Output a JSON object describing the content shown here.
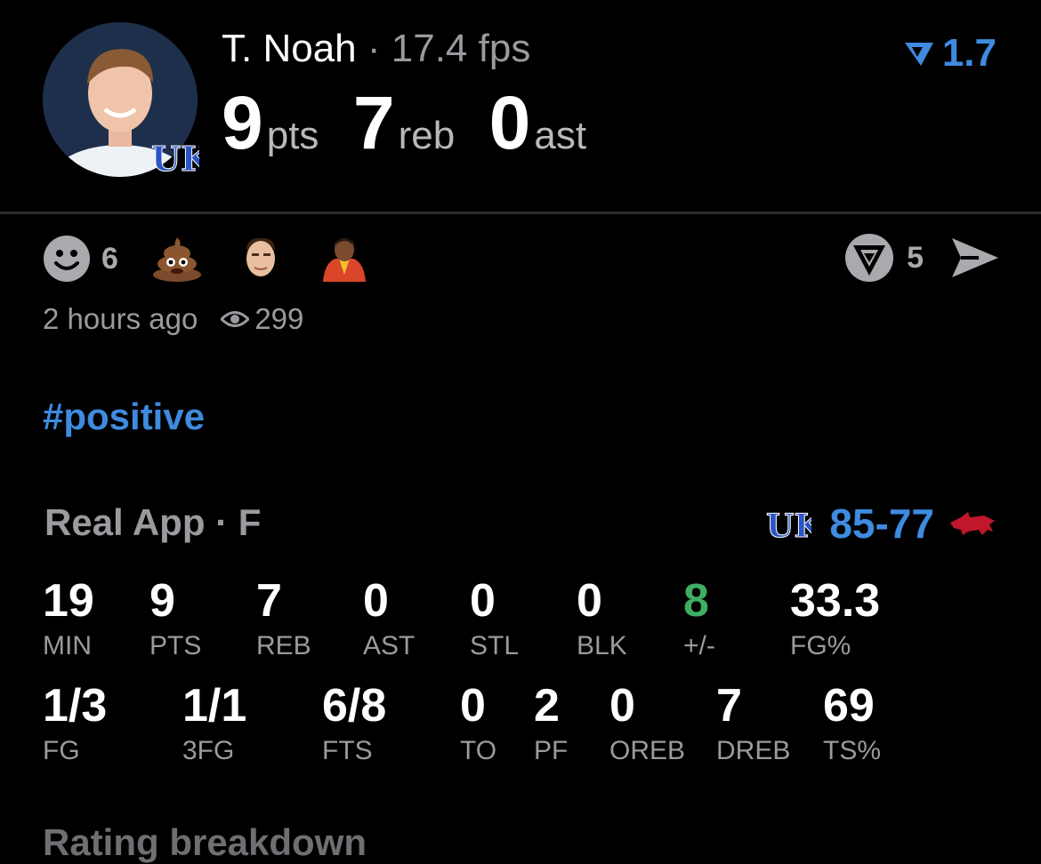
{
  "player": {
    "name": "T. Noah",
    "separator": "·",
    "fps": "17.4 fps"
  },
  "headline": {
    "pts_value": "9",
    "pts_unit": "pts",
    "reb_value": "7",
    "reb_unit": "reb",
    "ast_value": "0",
    "ast_unit": "ast"
  },
  "rating": {
    "value": "1.7",
    "color": "#3e8be0"
  },
  "reactions": {
    "smiley_count": "6",
    "emoji_names": [
      "poop-emoji",
      "player-face-sticker",
      "cheering-fan-sticker"
    ]
  },
  "actions": {
    "reshare_count": "5"
  },
  "meta": {
    "time_ago": "2 hours ago",
    "views": "299"
  },
  "hashtag": "#positive",
  "game": {
    "title": "Real App · F",
    "home_score": "85",
    "dash": "-",
    "away_score": "77",
    "home_team_icon": "kentucky-logo-icon",
    "away_team_icon": "arkansas-razorback-icon"
  },
  "stats_row1": [
    {
      "value": "19",
      "label": "MIN"
    },
    {
      "value": "9",
      "label": "PTS"
    },
    {
      "value": "7",
      "label": "REB"
    },
    {
      "value": "0",
      "label": "AST"
    },
    {
      "value": "0",
      "label": "STL"
    },
    {
      "value": "0",
      "label": "BLK"
    },
    {
      "value": "8",
      "label": "+/-"
    },
    {
      "value": "33.3",
      "label": "FG%"
    }
  ],
  "stats_row2": [
    {
      "value": "1/3",
      "label": "FG"
    },
    {
      "value": "1/1",
      "label": "3FG"
    },
    {
      "value": "6/8",
      "label": "FTS"
    },
    {
      "value": "0",
      "label": "TO"
    },
    {
      "value": "2",
      "label": "PF"
    },
    {
      "value": "0",
      "label": "OREB"
    },
    {
      "value": "7",
      "label": "DREB"
    },
    {
      "value": "69",
      "label": "TS%"
    }
  ],
  "colors": {
    "accent": "#3e8be0",
    "positive": "#3fae63",
    "muted": "#9a9a9f"
  },
  "next_section_heading": "Rating breakdown"
}
